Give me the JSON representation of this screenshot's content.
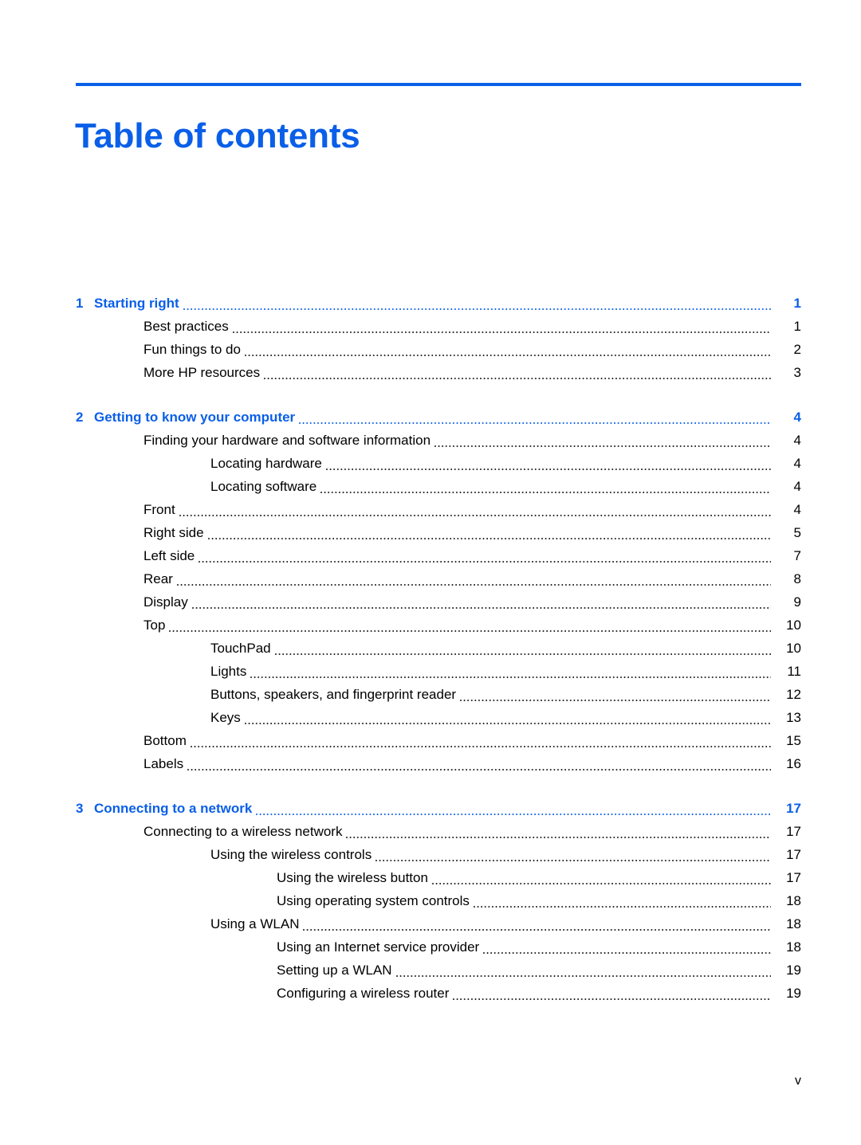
{
  "document": {
    "title": "Table of contents",
    "accent_color": "#0a5fe8",
    "text_color": "#000000",
    "folio": "v"
  },
  "toc": {
    "entries": [
      {
        "level": "chapter",
        "number": "1",
        "label": "Starting right",
        "page": "1"
      },
      {
        "level": "1",
        "number": "",
        "label": "Best practices",
        "page": "1"
      },
      {
        "level": "1",
        "number": "",
        "label": "Fun things to do",
        "page": "2"
      },
      {
        "level": "1",
        "number": "",
        "label": "More HP resources",
        "page": "3"
      },
      {
        "level": "chapter",
        "number": "2",
        "label": "Getting to know your computer",
        "page": "4"
      },
      {
        "level": "1",
        "number": "",
        "label": "Finding your hardware and software information",
        "page": "4"
      },
      {
        "level": "2",
        "number": "",
        "label": "Locating hardware",
        "page": "4"
      },
      {
        "level": "2",
        "number": "",
        "label": "Locating software",
        "page": "4"
      },
      {
        "level": "1",
        "number": "",
        "label": "Front",
        "page": "4"
      },
      {
        "level": "1",
        "number": "",
        "label": "Right side",
        "page": "5"
      },
      {
        "level": "1",
        "number": "",
        "label": "Left side",
        "page": "7"
      },
      {
        "level": "1",
        "number": "",
        "label": "Rear",
        "page": "8"
      },
      {
        "level": "1",
        "number": "",
        "label": "Display",
        "page": "9"
      },
      {
        "level": "1",
        "number": "",
        "label": "Top",
        "page": "10"
      },
      {
        "level": "2",
        "number": "",
        "label": "TouchPad",
        "page": "10"
      },
      {
        "level": "2",
        "number": "",
        "label": "Lights",
        "page": "11"
      },
      {
        "level": "2",
        "number": "",
        "label": "Buttons, speakers, and fingerprint reader",
        "page": "12"
      },
      {
        "level": "2",
        "number": "",
        "label": "Keys",
        "page": "13"
      },
      {
        "level": "1",
        "number": "",
        "label": "Bottom",
        "page": "15"
      },
      {
        "level": "1",
        "number": "",
        "label": "Labels",
        "page": "16"
      },
      {
        "level": "chapter",
        "number": "3",
        "label": "Connecting to a network",
        "page": "17"
      },
      {
        "level": "1",
        "number": "",
        "label": "Connecting to a wireless network",
        "page": "17"
      },
      {
        "level": "2",
        "number": "",
        "label": "Using the wireless controls",
        "page": "17"
      },
      {
        "level": "3",
        "number": "",
        "label": "Using the wireless button",
        "page": "17"
      },
      {
        "level": "3",
        "number": "",
        "label": "Using operating system controls",
        "page": "18"
      },
      {
        "level": "2",
        "number": "",
        "label": "Using a WLAN",
        "page": "18"
      },
      {
        "level": "3",
        "number": "",
        "label": "Using an Internet service provider",
        "page": "18"
      },
      {
        "level": "3",
        "number": "",
        "label": "Setting up a WLAN",
        "page": "19"
      },
      {
        "level": "3",
        "number": "",
        "label": "Configuring a wireless router",
        "page": "19"
      }
    ]
  }
}
